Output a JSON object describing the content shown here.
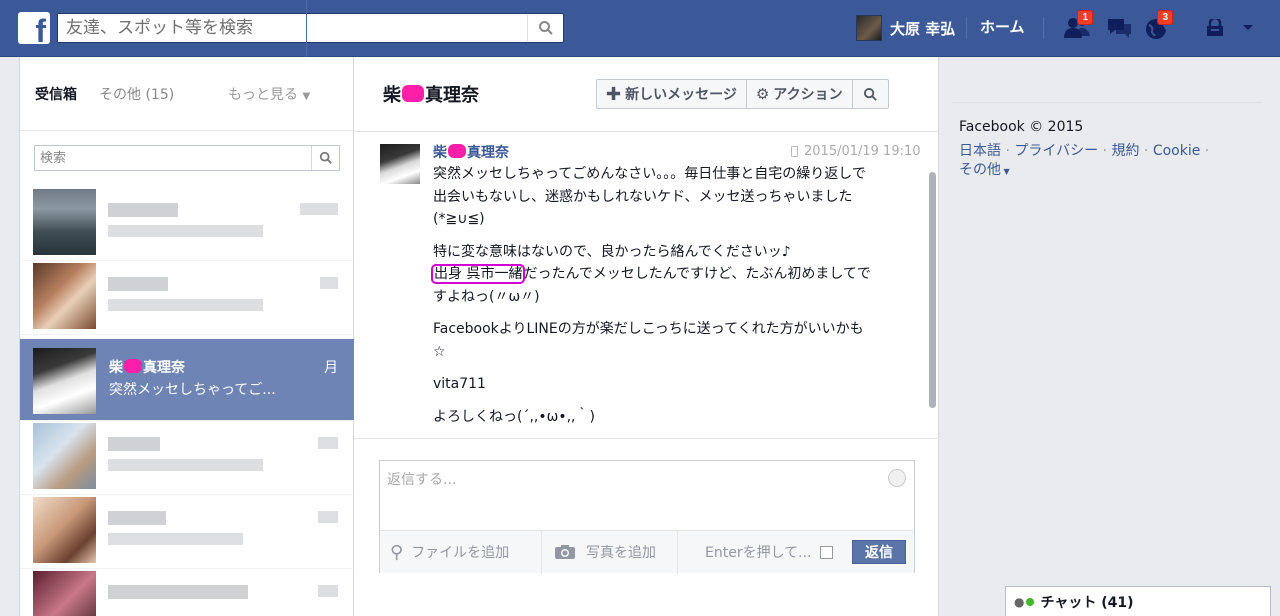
{
  "topbar": {
    "search_placeholder": "友達、スポット等を検索",
    "user_name": "大原 幸弘",
    "home_label": "ホーム",
    "friend_requests_count": "1",
    "notifications_count": "3"
  },
  "sidebar": {
    "tab_inbox": "受信箱",
    "tab_other": "その他 (15)",
    "tab_more": "もっと見る",
    "search_placeholder": "検索",
    "active_conversation": {
      "name_prefix": "柴",
      "name_suffix": "真理奈",
      "preview": "突然メッセしちゃってご...",
      "date": "月"
    }
  },
  "thread": {
    "title_prefix": "柴",
    "title_suffix": "真理奈",
    "new_message_label": "新しいメッセージ",
    "actions_label": "アクション",
    "message": {
      "sender_prefix": "柴",
      "sender_suffix": "真理奈",
      "timestamp": "2015/01/19 19:10",
      "para1": "突然メッセしちゃってごめんなさい。。。毎日仕事と自宅の繰り返しで出会いもないし、迷惑かもしれないケド、メッセ送っちゃいました(*≧∪≦)",
      "para2_line1": "特に変な意味はないので、良かったら絡んでくださいッ♪",
      "para2_highlight": "出身 呉市一緒",
      "para2_rest": "だったんでメッセしたんですけど、たぶん初めましてですよねっ(〃ω〃)",
      "para3": "FacebookよりLINEの方が楽だしこっちに送ってくれた方がいいかも☆",
      "para4": "vita711",
      "para5": "よろしくねっ(´,,•ω•,,｀)"
    },
    "reply_placeholder": "返信する...",
    "attach_file_label": "ファイルを追加",
    "attach_photo_label": "写真を追加",
    "enter_label": "Enterを押して...",
    "send_label": "返信"
  },
  "right": {
    "copyright": "Facebook © 2015",
    "links": [
      "日本語",
      "プライバシー",
      "規約",
      "Cookie"
    ],
    "more_label": "その他"
  },
  "chat": {
    "label": "チャット (41)"
  }
}
